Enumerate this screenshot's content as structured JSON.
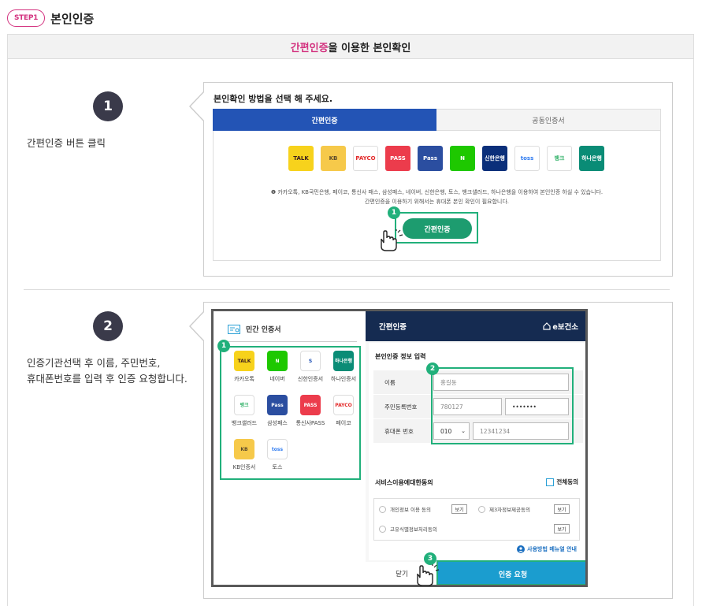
{
  "header": {
    "step_badge": "STEP1",
    "title": "본인인증"
  },
  "section": {
    "title_highlight": "간편인증",
    "title_rest": "을 이용한 본인확인"
  },
  "step1": {
    "number": "1",
    "description": "간편인증 버튼 클릭",
    "panel_title": "본인확인 방법을 선택 해 주세요.",
    "tabs": [
      {
        "label": "간편인증",
        "active": true
      },
      {
        "label": "공동인증서",
        "active": false
      }
    ],
    "banks": [
      {
        "label": "TALK",
        "color": "#f7d21c",
        "text_color": "#3b1e1e"
      },
      {
        "label": "KB",
        "color": "#f6c94a",
        "text_color": "#5b4a2c"
      },
      {
        "label": "PAYCO",
        "color": "#ffffff",
        "text_color": "#e32a2a"
      },
      {
        "label": "PASS",
        "color": "#ec3c4c",
        "text_color": "#ffffff"
      },
      {
        "label": "Pass",
        "color": "#2b4ea0",
        "text_color": "#ffffff"
      },
      {
        "label": "N",
        "color": "#1ec800",
        "text_color": "#ffffff"
      },
      {
        "label": "신한은행",
        "color": "#0b2f7a",
        "text_color": "#ffffff"
      },
      {
        "label": "toss",
        "color": "#ffffff",
        "text_color": "#2f7bf0"
      },
      {
        "label": "뱅크",
        "color": "#ffffff",
        "text_color": "#35b36b"
      },
      {
        "label": "하나은행",
        "color": "#0a8c76",
        "text_color": "#ffffff"
      }
    ],
    "note_line1": "❶ 카카오톡, KB국민은행, 페이코, 통신사 패스, 삼성패스, 네이버, 신한은행, 토스, 뱅크샐러드, 하나은행을 이용하여 본인인증 하실 수 있습니다.",
    "note_line2": "간편인증을 이용하기 위해서는 휴대폰 본인 확인이 필요합니다.",
    "callout_badge": "1",
    "button_label": "간편인증"
  },
  "step2": {
    "number": "2",
    "description_line1": "인증기관선택 후 이름, 주민번호,",
    "description_line2": "휴대폰번호를 입력 후 인증 요청합니다.",
    "left_title": "민간 인증서",
    "providers": [
      {
        "label": "카카오톡",
        "icon": "TALK",
        "color": "#f7d21c",
        "text_color": "#3b1e1e"
      },
      {
        "label": "네이버",
        "icon": "N",
        "color": "#1ec800",
        "text_color": "#ffffff"
      },
      {
        "label": "신한인증서",
        "icon": "S",
        "color": "#ffffff",
        "text_color": "#1b4eb5"
      },
      {
        "label": "하나인증서",
        "icon": "하나은행",
        "color": "#0a8c76",
        "text_color": "#ffffff"
      },
      {
        "label": "뱅크샐러드",
        "icon": "뱅크",
        "color": "#ffffff",
        "text_color": "#35b36b"
      },
      {
        "label": "삼성패스",
        "icon": "Pass",
        "color": "#2b4ea0",
        "text_color": "#ffffff"
      },
      {
        "label": "통신사PASS",
        "icon": "PASS",
        "color": "#ec3c4c",
        "text_color": "#ffffff"
      },
      {
        "label": "페이코",
        "icon": "PAYCO",
        "color": "#ffffff",
        "text_color": "#e32a2a"
      },
      {
        "label": "KB인증서",
        "icon": "KB",
        "color": "#f6c94a",
        "text_color": "#5b4a2c"
      },
      {
        "label": "토스",
        "icon": "toss",
        "color": "#ffffff",
        "text_color": "#2f7bf0"
      }
    ],
    "right_title": "간편인증",
    "brand": "e보건소",
    "form_title": "본인인증 정보 입력",
    "name_label": "이름",
    "name_value": "홍길동",
    "rrn_label": "주민등록번호",
    "rrn_front": "780127",
    "rrn_back": "•••••••",
    "phone_label": "휴대폰 번호",
    "phone_prefix": "010",
    "phone_value": "12341234",
    "agree_title": "서비스이용에대한동의",
    "agree_all": "전체동의",
    "agree_items": [
      "개인정보 이용 동의",
      "제3자정보제공동의",
      "고유식별정보처리동의"
    ],
    "view_label": "보기",
    "guide_link": "사용방법 메뉴얼 안내",
    "close_label": "닫기",
    "request_label": "인증 요청",
    "badges": [
      "1",
      "2",
      "3"
    ]
  }
}
